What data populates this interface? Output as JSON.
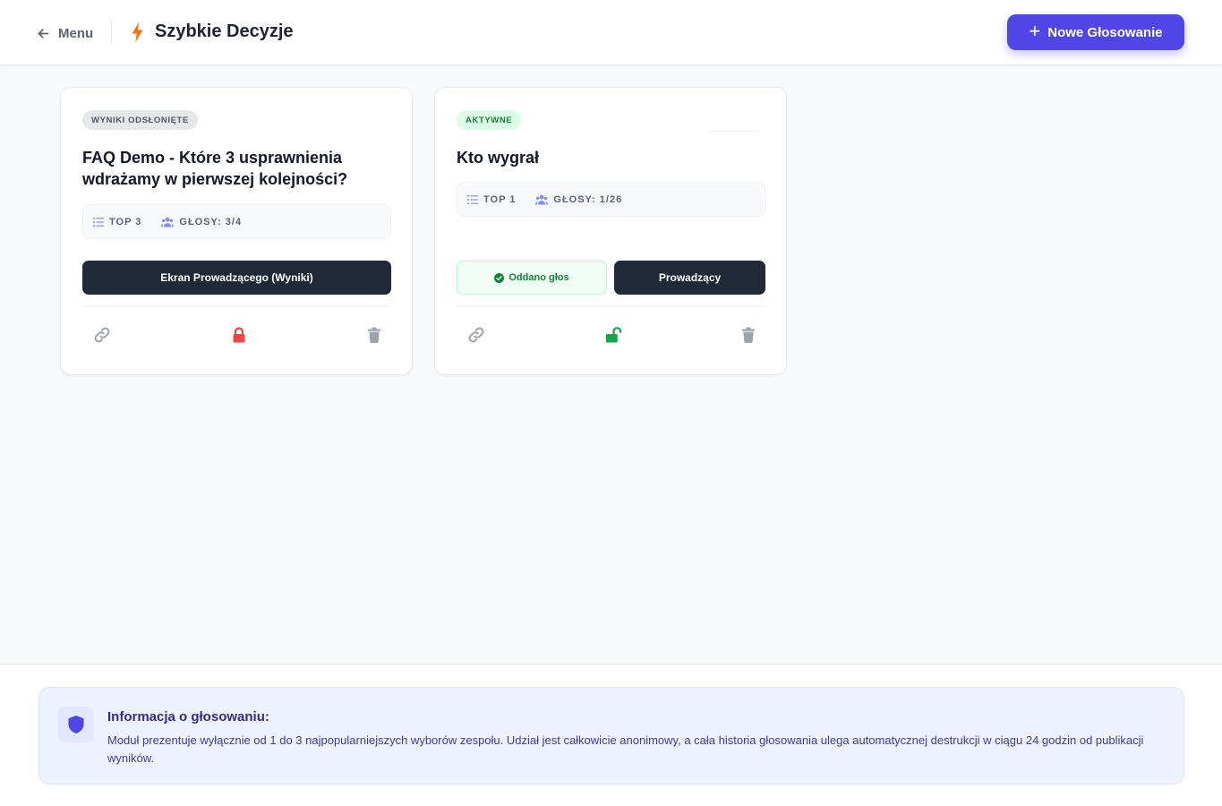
{
  "header": {
    "back_label": "Menu",
    "app_title": "Szybkie Decyzje",
    "new_button_label": "Nowe Głosowanie"
  },
  "polls": [
    {
      "status": "WYNIKI ODSŁONIĘTE",
      "title": "FAQ Demo - Które 3 usprawnienia wdrażamy w pierwszej kolejności?",
      "top_label": "TOP 3",
      "votes_label": "GŁOSY: 3/4",
      "primary_button": "Ekran Prowadzącego (Wyniki)",
      "locked": true
    },
    {
      "status": "AKTYWNE",
      "title": "Kto wygrał",
      "top_label": "TOP 1",
      "votes_label": "GŁOSY: 1/26",
      "voted_label": "Oddano głos",
      "primary_button": "Prowadzący",
      "locked": false
    }
  ],
  "info": {
    "title": "Informacja o głosowaniu:",
    "text": "Moduł prezentuje wyłącznie od 1 do 3 najpopularniejszych wyborów zespołu. Udział jest całkowicie anonimowy, a cała historia głosowania ulega automatycznej destrukcji w ciągu 24 godzin od publikacji wyników."
  },
  "colors": {
    "accent": "#4f46e5",
    "dark_button": "#1f2937",
    "lock_red": "#ef4444",
    "unlock_green": "#16a34a",
    "brand_bolt": "#f97316"
  },
  "icons": [
    "arrow-left-icon",
    "bolt-icon",
    "plus-icon",
    "list-ordered-icon",
    "users-icon",
    "check-circle-icon",
    "link-icon",
    "lock-icon",
    "unlock-icon",
    "trash-icon",
    "shield-icon"
  ]
}
